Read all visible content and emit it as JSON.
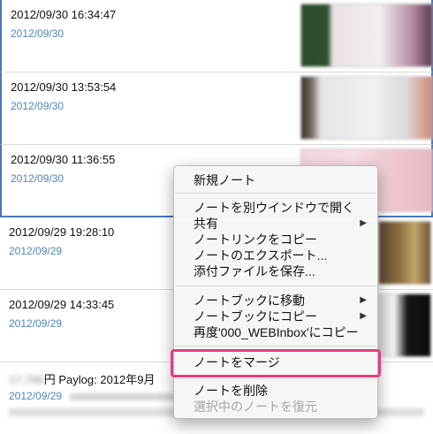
{
  "notes": [
    {
      "title": "2012/09/30 16:34:47",
      "date": "2012/09/30"
    },
    {
      "title": "2012/09/30 13:53:54",
      "date": "2012/09/30"
    },
    {
      "title": "2012/09/30 11:36:55",
      "date": "2012/09/30"
    },
    {
      "title": "2012/09/29 19:28:10",
      "date": "2012/09/29"
    },
    {
      "title": "2012/09/29 14:33:45",
      "date": "2012/09/29"
    },
    {
      "title_hidden": "17,796",
      "title": "円 Paylog: 2012年9月",
      "date": "2012/09/29"
    }
  ],
  "context_menu": {
    "new_note": "新規ノート",
    "open_in_window": "ノートを別ウインドウで開く",
    "share": "共有",
    "copy_link": "ノートリンクをコピー",
    "export": "ノートのエクスポート...",
    "save_attachment": "添付ファイルを保存...",
    "move_to_notebook": "ノートブックに移動",
    "copy_to_notebook": "ノートブックにコピー",
    "recopy": "再度'000_WEBInbox'にコピー",
    "merge": "ノートをマージ",
    "delete": "ノートを削除",
    "restore": "選択中のノートを復元",
    "submenu_arrow": "▶"
  },
  "colors": {
    "selection_border": "#4a78b8",
    "date_text": "#4d86b8",
    "highlight": "#e33e7c"
  }
}
